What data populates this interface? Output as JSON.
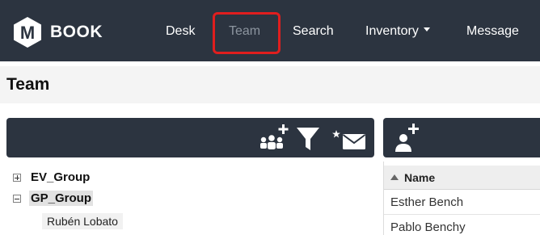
{
  "brand": {
    "name": "BOOK",
    "logo_letter": "M"
  },
  "nav": {
    "items": [
      {
        "label": "Desk"
      },
      {
        "label": "Team"
      },
      {
        "label": "Search"
      },
      {
        "label": "Inventory"
      },
      {
        "label": "Message"
      }
    ],
    "active": "Team"
  },
  "page": {
    "title": "Team"
  },
  "left_panel": {
    "toolbar_icons": [
      "add-group-icon",
      "filter-icon",
      "bulk-message-icon"
    ],
    "tree": [
      {
        "label": "EV_Group",
        "expanded": false
      },
      {
        "label": "GP_Group",
        "expanded": true,
        "selected": true,
        "children": [
          {
            "label": "Rubén Lobato"
          }
        ]
      }
    ]
  },
  "right_panel": {
    "toolbar_icons": [
      "add-user-icon"
    ],
    "grid": {
      "header": "Name",
      "sort": "ascending",
      "rows": [
        {
          "name": "Esther Bench"
        },
        {
          "name": "Pablo Benchy"
        }
      ]
    }
  },
  "colors": {
    "navbar": "#2c3440",
    "nav_active_text": "#8c959f",
    "highlight": "#e01e1e",
    "page_header_bg": "#f4f4f4"
  }
}
